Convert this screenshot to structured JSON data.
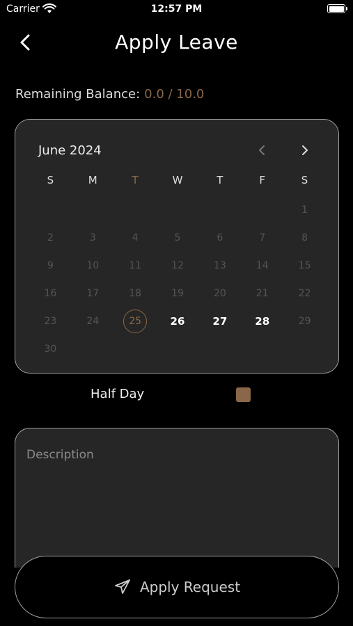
{
  "status": {
    "carrier": "Carrier",
    "time": "12:57 PM"
  },
  "nav": {
    "title": "Apply Leave"
  },
  "balance": {
    "label": "Remaining Balance:",
    "value": "0.0 / 10.0"
  },
  "calendar": {
    "month": "June 2024",
    "weekdays": [
      "S",
      "M",
      "T",
      "W",
      "T",
      "F",
      "S"
    ],
    "highlight_weekday_index": 2,
    "days": [
      {
        "d": "",
        "s": "empty"
      },
      {
        "d": "",
        "s": "empty"
      },
      {
        "d": "",
        "s": "empty"
      },
      {
        "d": "",
        "s": "empty"
      },
      {
        "d": "",
        "s": "empty"
      },
      {
        "d": "",
        "s": "empty"
      },
      {
        "d": "1",
        "s": "disabled"
      },
      {
        "d": "2",
        "s": "disabled"
      },
      {
        "d": "3",
        "s": "disabled"
      },
      {
        "d": "4",
        "s": "disabled"
      },
      {
        "d": "5",
        "s": "disabled"
      },
      {
        "d": "6",
        "s": "disabled"
      },
      {
        "d": "7",
        "s": "disabled"
      },
      {
        "d": "8",
        "s": "disabled"
      },
      {
        "d": "9",
        "s": "disabled"
      },
      {
        "d": "10",
        "s": "disabled"
      },
      {
        "d": "11",
        "s": "disabled"
      },
      {
        "d": "12",
        "s": "disabled"
      },
      {
        "d": "13",
        "s": "disabled"
      },
      {
        "d": "14",
        "s": "disabled"
      },
      {
        "d": "15",
        "s": "disabled"
      },
      {
        "d": "16",
        "s": "disabled"
      },
      {
        "d": "17",
        "s": "disabled"
      },
      {
        "d": "18",
        "s": "disabled"
      },
      {
        "d": "19",
        "s": "disabled"
      },
      {
        "d": "20",
        "s": "disabled"
      },
      {
        "d": "21",
        "s": "disabled"
      },
      {
        "d": "22",
        "s": "disabled"
      },
      {
        "d": "23",
        "s": "disabled"
      },
      {
        "d": "24",
        "s": "disabled"
      },
      {
        "d": "25",
        "s": "today"
      },
      {
        "d": "26",
        "s": "enabled"
      },
      {
        "d": "27",
        "s": "enabled"
      },
      {
        "d": "28",
        "s": "enabled"
      },
      {
        "d": "29",
        "s": "disabled"
      },
      {
        "d": "30",
        "s": "disabled"
      }
    ]
  },
  "half_day": {
    "label": "Half Day"
  },
  "description": {
    "placeholder": "Description",
    "value": ""
  },
  "apply": {
    "label": "Apply Request"
  },
  "colors": {
    "accent": "#8a6748",
    "border": "#9aa3a0",
    "card": "#262626",
    "bg": "#000000"
  },
  "icons": {
    "back": "chevron-left-icon",
    "prev": "chevron-left-icon",
    "next": "chevron-right-icon",
    "send": "paper-plane-icon"
  }
}
